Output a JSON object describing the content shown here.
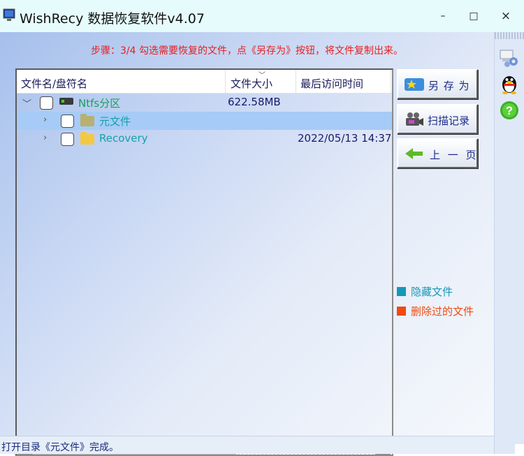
{
  "window": {
    "title": "WishRecy 数据恢复软件v4.07",
    "minimize_glyph": "–",
    "maximize_glyph": "□",
    "close_glyph": "×"
  },
  "instruction": "步骤：3/4 勾选需要恢复的文件，点《另存为》按钮，将文件复制出来。",
  "columns": {
    "name": "文件名/盘符名",
    "size": "文件大小",
    "accessed": "最后访问时间"
  },
  "tree": [
    {
      "name": "Ntfs分区",
      "size": "622.58MB",
      "date": "",
      "icon": "drive-icon",
      "name_color": "#1aa05a",
      "expanded": true,
      "checked": false
    },
    {
      "name": "元文件",
      "size": "",
      "date": "",
      "icon": "folder-icon",
      "name_color": "#17a0a8",
      "folder_color": "#b8b070",
      "expanded": false,
      "checked": false,
      "selected": true
    },
    {
      "name": "Recovery",
      "size": "",
      "date": "2022/05/13 14:37:",
      "icon": "folder-icon",
      "name_color": "#17a0a8",
      "folder_color": "#f5c842",
      "expanded": false,
      "checked": false
    }
  ],
  "actions": {
    "save_as": "另 存 为",
    "scan_record": "扫描记录",
    "prev_page": "上 一 页"
  },
  "legend": {
    "hidden": {
      "label": "隐藏文件",
      "color": "#1698b8"
    },
    "deleted": {
      "label": "删除过的文件",
      "color": "#f04a10"
    }
  },
  "side_toolbar": [
    "network-settings-icon",
    "qq-penguin-icon",
    "help-icon"
  ],
  "status": "打开目录《元文件》完成。"
}
